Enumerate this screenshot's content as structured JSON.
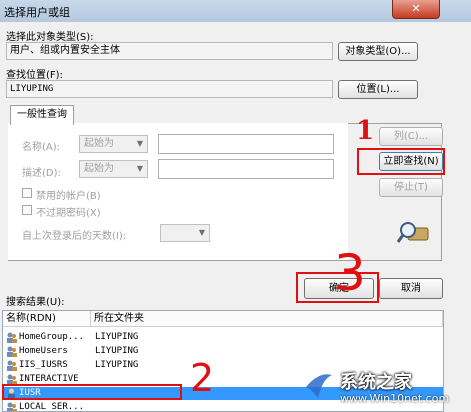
{
  "window": {
    "title": "选择用户或组",
    "close_glyph": "✕"
  },
  "object_type": {
    "label": "选择此对象类型(S):",
    "value": "用户、组或内置安全主体",
    "button": "对象类型(O)..."
  },
  "location": {
    "label": "查找位置(F):",
    "value": "LIYUPING",
    "button": "位置(L)..."
  },
  "query_tab": {
    "label": "一般性查询"
  },
  "query": {
    "name_label": "名称(A):",
    "name_mode": "起始为",
    "desc_label": "描述(D):",
    "desc_mode": "起始为",
    "disabled_accounts": "禁用的帐户(B)",
    "nonexpiring_password": "不过期密码(X)",
    "days_since_logon_label": "自上次登录后的天数(I):"
  },
  "side_buttons": {
    "columns": "列(C)...",
    "find_now": "立即查找(N)",
    "stop": "停止(T)"
  },
  "dialog_buttons": {
    "ok": "确定",
    "cancel": "取消"
  },
  "results": {
    "label": "搜索结果(U):",
    "columns": [
      "名称(RDN)",
      "所在文件夹"
    ],
    "rows": [
      {
        "name": "HomeGroup...",
        "folder": "LIYUPING"
      },
      {
        "name": "HomeUsers",
        "folder": "LIYUPING"
      },
      {
        "name": "IIS_IUSRS",
        "folder": "LIYUPING"
      },
      {
        "name": "INTERACTIVE",
        "folder": ""
      },
      {
        "name": "IUSR",
        "folder": ""
      },
      {
        "name": "LOCAL SER...",
        "folder": ""
      }
    ]
  },
  "annotations": {
    "mark_1": "1",
    "mark_2": "2",
    "mark_3": "3",
    "color": "#e01010"
  },
  "watermark": {
    "brand": "系统之家",
    "url": "www.Win10net.com"
  },
  "colors": {
    "selection": "#3399ff",
    "annotation": "#e01010"
  }
}
